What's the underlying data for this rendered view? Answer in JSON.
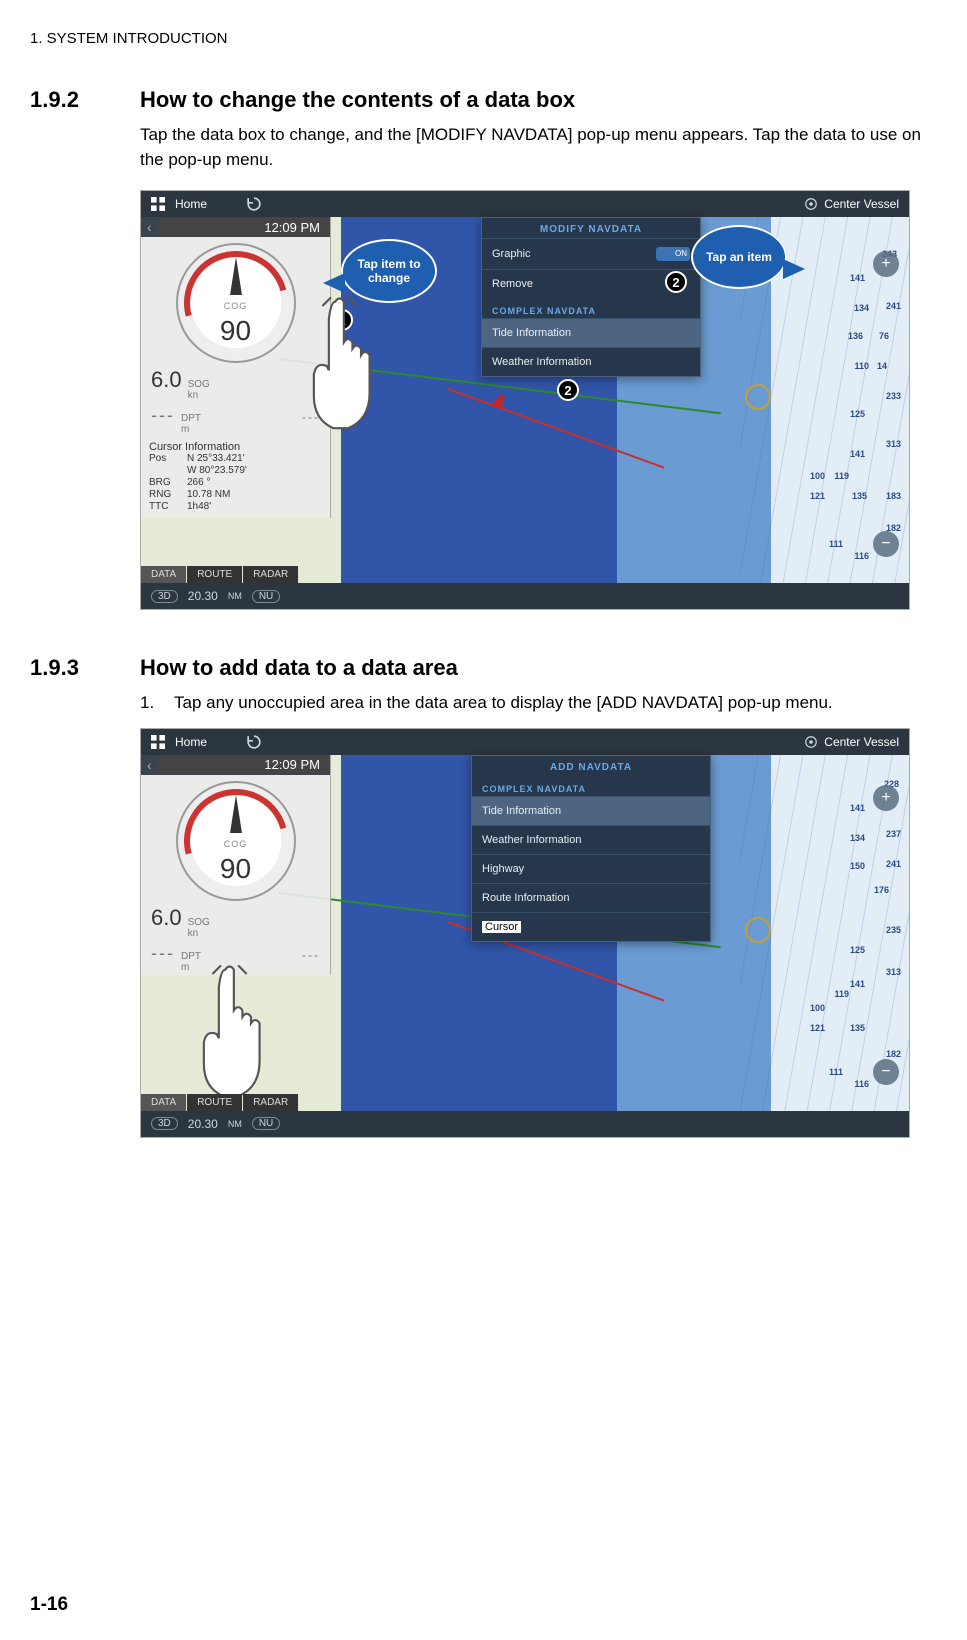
{
  "header": {
    "running": "1.  SYSTEM INTRODUCTION"
  },
  "section1": {
    "num": "1.9.2",
    "title": "How to change the contents of a data box",
    "body": "Tap the data box to change, and the [MODIFY NAVDATA] pop-up menu appears. Tap the data to use on the pop-up menu."
  },
  "section2": {
    "num": "1.9.3",
    "title": "How to add data to a data area",
    "step1_num": "1.",
    "step1_text": "Tap any unoccupied area in the data area to display the [ADD NAVDATA] pop-up menu."
  },
  "common": {
    "home": "Home",
    "center_vessel": "Center Vessel",
    "time": "12:09 PM",
    "cog_label": "COG",
    "cog_value": "90",
    "sog_value": "6.0",
    "sog_label": "SOG",
    "sog_unit": "kn",
    "dpt_label": "DPT",
    "dpt_unit": "m",
    "dash": "---",
    "ci_title": "Cursor Information",
    "ci": {
      "pos_lbl": "Pos",
      "pos_lat": "N 25°33.421'",
      "pos_lon": "W 80°23.579'",
      "brg_lbl": "BRG",
      "brg_val": "266 °",
      "rng_lbl": "RNG",
      "rng_val": "10.78 NM",
      "ttc_lbl": "TTC",
      "ttc_val": "1h48'"
    },
    "tabs": {
      "data": "DATA",
      "route": "ROUTE",
      "radar": "RADAR"
    },
    "scale": "20.30",
    "scale_unit": "NM",
    "three_d": "3D",
    "nu": "NU"
  },
  "popup1": {
    "title": "MODIFY NAVDATA",
    "graphic": "Graphic",
    "toggle": "ON",
    "remove": "Remove",
    "sub": "COMPLEX NAVDATA",
    "tide": "Tide Information",
    "weather": "Weather Information"
  },
  "popup2": {
    "title": "ADD NAVDATA",
    "sub": "COMPLEX NAVDATA",
    "tide": "Tide Information",
    "weather": "Weather Information",
    "highway": "Highway",
    "route": "Route Information",
    "cursor": "Cursor"
  },
  "callouts": {
    "tap_change": "Tap item to change",
    "tap_item": "Tap an item"
  },
  "depths": {
    "d1": "243",
    "d2": "141",
    "d3": "134",
    "d4": "241",
    "d5": "76",
    "d6": "136",
    "d7": "110",
    "d8": "14",
    "d9": "233",
    "d10": "125",
    "d11": "135",
    "d12": "141",
    "d13": "119",
    "d14": "313",
    "d15": "182",
    "d16": "100",
    "d17": "121",
    "d18": "183",
    "d19": "111",
    "d20": "116",
    "d21": "228",
    "d22": "237",
    "d23": "150",
    "d24": "176",
    "d25": "235"
  },
  "page_number": "1-16"
}
